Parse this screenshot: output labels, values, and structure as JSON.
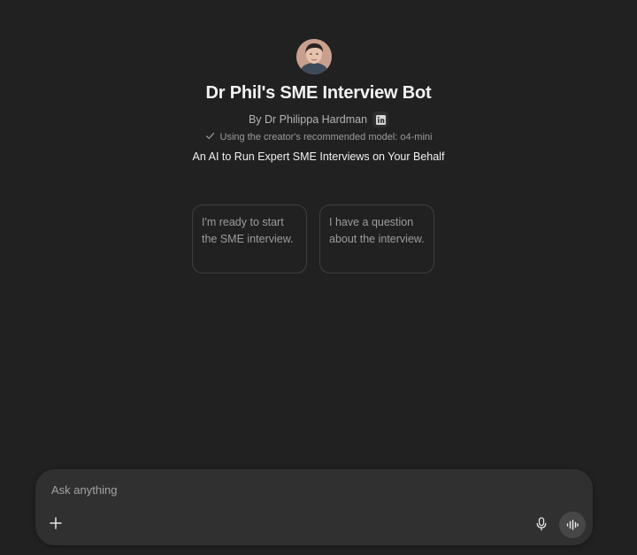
{
  "gpt": {
    "title": "Dr Phil's SME Interview Bot",
    "byline": "By Dr Philippa Hardman",
    "model_note": "Using the creator's recommended model: o4-mini",
    "tagline": "An AI to Run Expert SME Interviews on Your Behalf"
  },
  "starters": [
    {
      "label": "I'm ready to start the SME interview."
    },
    {
      "label": "I have a question about the interview."
    }
  ],
  "composer": {
    "placeholder": "Ask anything"
  },
  "icons": {
    "avatar": "creator-avatar",
    "linkedin": "linkedin-icon",
    "check": "check-icon",
    "plus": "plus-icon",
    "mic": "microphone-icon",
    "voice": "voice-mode-icon"
  },
  "colors": {
    "background": "#212121",
    "composer": "#303030",
    "card_border": "#3f3f3f",
    "voice_button": "#474747"
  }
}
